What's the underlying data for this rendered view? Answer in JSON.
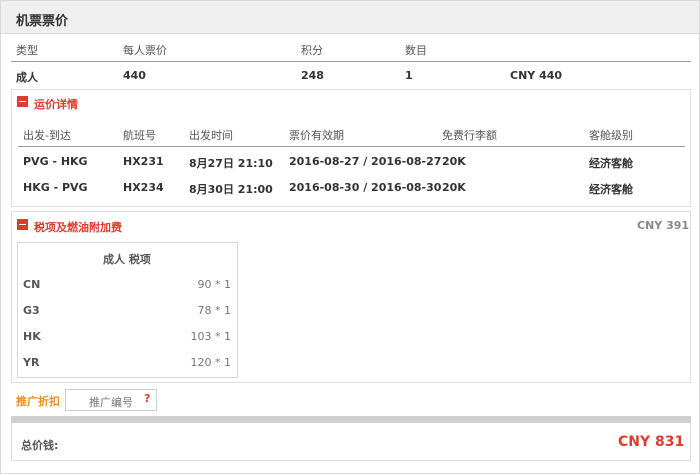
{
  "header": {
    "title": "机票票价"
  },
  "summary": {
    "columns": [
      "类型",
      "每人票价",
      "积分",
      "数目"
    ],
    "row": {
      "type": "成人",
      "price": "440",
      "points": "248",
      "count": "1",
      "total": "CNY 440"
    }
  },
  "fare_details": {
    "title": "运价详情",
    "columns": [
      "出发-到达",
      "航班号",
      "出发时间",
      "票价有效期",
      "免费行李额",
      "客舱级别"
    ],
    "rows": [
      {
        "route": "PVG - HKG",
        "flight": "HX231",
        "depart": "8月27日 21:10",
        "validity": "2016-08-27 / 2016-08-27",
        "baggage": "20K",
        "cabin": "经济客舱"
      },
      {
        "route": "HKG - PVG",
        "flight": "HX234",
        "depart": "8月30日 21:00",
        "validity": "2016-08-30 / 2016-08-30",
        "baggage": "20K",
        "cabin": "经济客舱"
      }
    ]
  },
  "taxes": {
    "title": "税项及燃油附加费",
    "total": "CNY 391",
    "table_header": "成人 税项",
    "rows": [
      {
        "code": "CN",
        "value": "90 * 1"
      },
      {
        "code": "G3",
        "value": "78 * 1"
      },
      {
        "code": "HK",
        "value": "103 * 1"
      },
      {
        "code": "YR",
        "value": "120 * 1"
      }
    ]
  },
  "promo": {
    "label": "推广折扣",
    "placeholder": "推广编号",
    "help": "?"
  },
  "total": {
    "label": "总价钱:",
    "value": "CNY 831"
  },
  "colors": {
    "accent_red": "#e03c2c",
    "accent_orange": "#f28c1a"
  },
  "icons": {
    "collapse": "minus-square-icon",
    "help": "question-icon"
  }
}
